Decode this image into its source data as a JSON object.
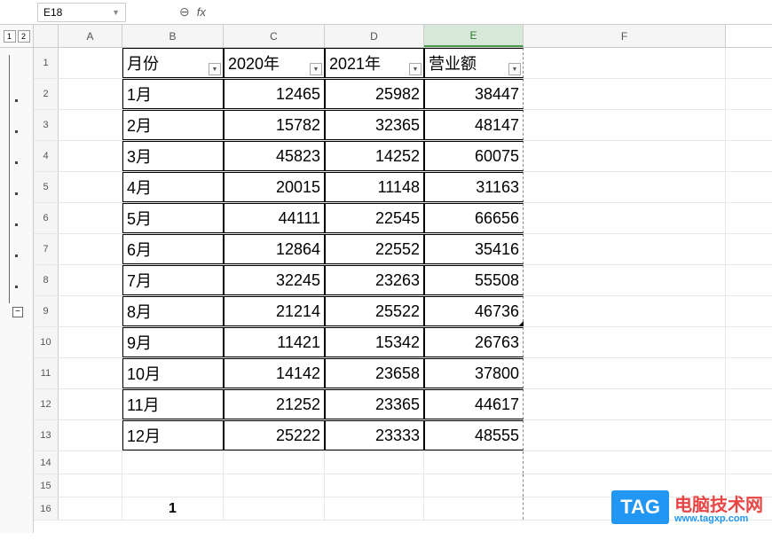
{
  "formulaBar": {
    "nameBox": "E18",
    "fxLabel": "fx"
  },
  "outline": {
    "levels": [
      "1",
      "2"
    ]
  },
  "columns": [
    "A",
    "B",
    "C",
    "D",
    "E",
    "F"
  ],
  "selectedColumn": "E",
  "headerRow": {
    "rowNum": "1",
    "b": "月份",
    "c": "2020年",
    "d": "2021年",
    "e": "营业额"
  },
  "dataRows": [
    {
      "rowNum": "2",
      "b": "1月",
      "c": "12465",
      "d": "25982",
      "e": "38447"
    },
    {
      "rowNum": "3",
      "b": "2月",
      "c": "15782",
      "d": "32365",
      "e": "48147"
    },
    {
      "rowNum": "4",
      "b": "3月",
      "c": "45823",
      "d": "14252",
      "e": "60075"
    },
    {
      "rowNum": "5",
      "b": "4月",
      "c": "20015",
      "d": "11148",
      "e": "31163"
    },
    {
      "rowNum": "6",
      "b": "5月",
      "c": "44111",
      "d": "22545",
      "e": "66656"
    },
    {
      "rowNum": "7",
      "b": "6月",
      "c": "12864",
      "d": "22552",
      "e": "35416"
    },
    {
      "rowNum": "8",
      "b": "7月",
      "c": "32245",
      "d": "23263",
      "e": "55508"
    },
    {
      "rowNum": "9",
      "b": "8月",
      "c": "21214",
      "d": "25522",
      "e": "46736"
    },
    {
      "rowNum": "10",
      "b": "9月",
      "c": "11421",
      "d": "15342",
      "e": "26763"
    },
    {
      "rowNum": "11",
      "b": "10月",
      "c": "14142",
      "d": "23658",
      "e": "37800"
    },
    {
      "rowNum": "12",
      "b": "11月",
      "c": "21252",
      "d": "23365",
      "e": "44617"
    },
    {
      "rowNum": "13",
      "b": "12月",
      "c": "25222",
      "d": "23333",
      "e": "48555"
    }
  ],
  "emptyRows": [
    {
      "rowNum": "14"
    },
    {
      "rowNum": "15"
    }
  ],
  "summaryRow": {
    "rowNum": "16",
    "b": "1"
  },
  "watermark": {
    "tag": "TAG",
    "text": "电脑技术网",
    "url": "www.tagxp.com"
  },
  "chart_data": {
    "type": "table",
    "title": "营业额",
    "columns": [
      "月份",
      "2020年",
      "2021年",
      "营业额"
    ],
    "rows": [
      [
        "1月",
        12465,
        25982,
        38447
      ],
      [
        "2月",
        15782,
        32365,
        48147
      ],
      [
        "3月",
        45823,
        14252,
        60075
      ],
      [
        "4月",
        20015,
        11148,
        31163
      ],
      [
        "5月",
        44111,
        22545,
        66656
      ],
      [
        "6月",
        12864,
        22552,
        35416
      ],
      [
        "7月",
        32245,
        23263,
        55508
      ],
      [
        "8月",
        21214,
        25522,
        46736
      ],
      [
        "9月",
        11421,
        15342,
        26763
      ],
      [
        "10月",
        14142,
        23658,
        37800
      ],
      [
        "11月",
        21252,
        23365,
        44617
      ],
      [
        "12月",
        25222,
        23333,
        48555
      ]
    ]
  }
}
